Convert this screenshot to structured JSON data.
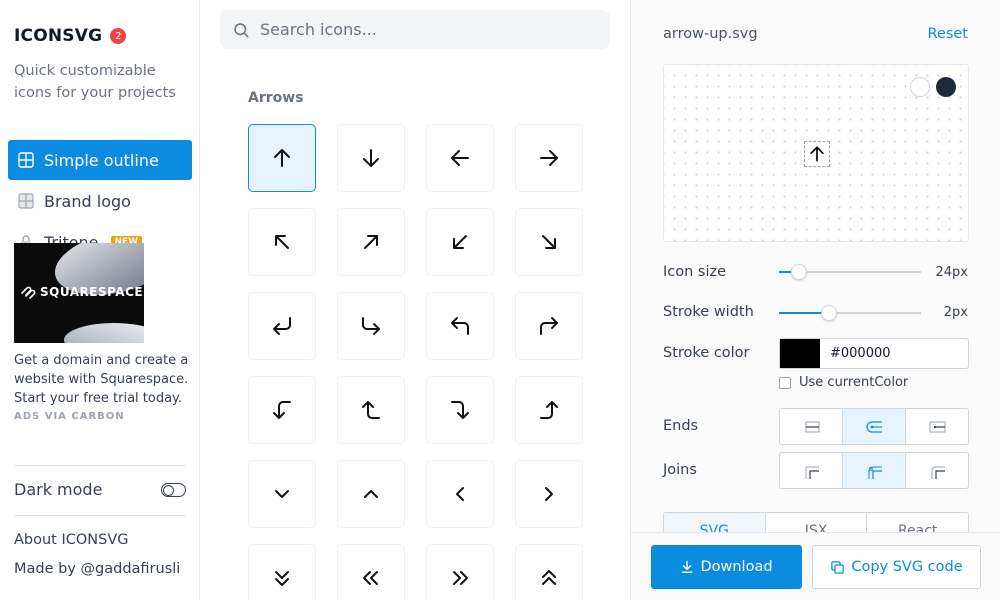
{
  "app": {
    "name": "ICONSVG",
    "badge_count": "2",
    "tagline": "Quick customizable icons for your projects"
  },
  "sidebar": {
    "nav": [
      {
        "label": "Simple outline",
        "icon": "grid-icon",
        "active": true
      },
      {
        "label": "Brand logo",
        "icon": "grid-icon",
        "active": false
      },
      {
        "label": "Tritone",
        "icon": "lock-icon",
        "active": false,
        "badge": "NEW"
      }
    ],
    "ad": {
      "brand": "SQUARESPACE",
      "text": "Get a domain and create a website with Squarespace. Start your free trial today.",
      "via": "ADS VIA CARBON"
    },
    "dark_mode_label": "Dark mode",
    "dark_mode_on": false,
    "about_label": "About ICONSVG",
    "made_by_label": "Made by @gaddafirusli"
  },
  "search": {
    "placeholder": "Search icons..."
  },
  "gallery": {
    "section_title": "Arrows",
    "selected_index": 0,
    "icons": [
      "arrow-up-icon",
      "arrow-down-icon",
      "arrow-left-icon",
      "arrow-right-icon",
      "arrow-up-left-icon",
      "arrow-up-right-icon",
      "arrow-down-left-icon",
      "arrow-down-right-icon",
      "corner-down-left-icon",
      "corner-down-right-icon",
      "corner-up-left-icon",
      "corner-up-right-icon",
      "corner-left-down-icon",
      "corner-left-up-icon",
      "corner-right-down-icon",
      "corner-right-up-icon",
      "chevron-down-icon",
      "chevron-up-icon",
      "chevron-left-icon",
      "chevron-right-icon",
      "chevrons-down-icon",
      "chevrons-left-icon",
      "chevrons-right-icon",
      "chevrons-up-icon"
    ]
  },
  "panel": {
    "file_name": "arrow-up.svg",
    "reset_label": "Reset",
    "icon_size_label": "Icon size",
    "icon_size_value": "24px",
    "icon_size_fraction": 0.14,
    "stroke_width_label": "Stroke width",
    "stroke_width_value": "2px",
    "stroke_width_fraction": 0.35,
    "stroke_color_label": "Stroke color",
    "stroke_color_value": "#000000",
    "use_current_color_label": "Use currentColor",
    "use_current_color_checked": false,
    "ends_label": "Ends",
    "ends_selected_index": 1,
    "joins_label": "Joins",
    "joins_selected_index": 1,
    "tabs": [
      "SVG",
      "JSX",
      "React"
    ],
    "active_tab_index": 0,
    "download_label": "Download",
    "copy_label": "Copy SVG code"
  },
  "colors": {
    "accent": "#0c8ce0",
    "badge_red": "#ef4444",
    "new_badge": "#f59e0b",
    "preview_dark_swatch": "#1e293b"
  }
}
